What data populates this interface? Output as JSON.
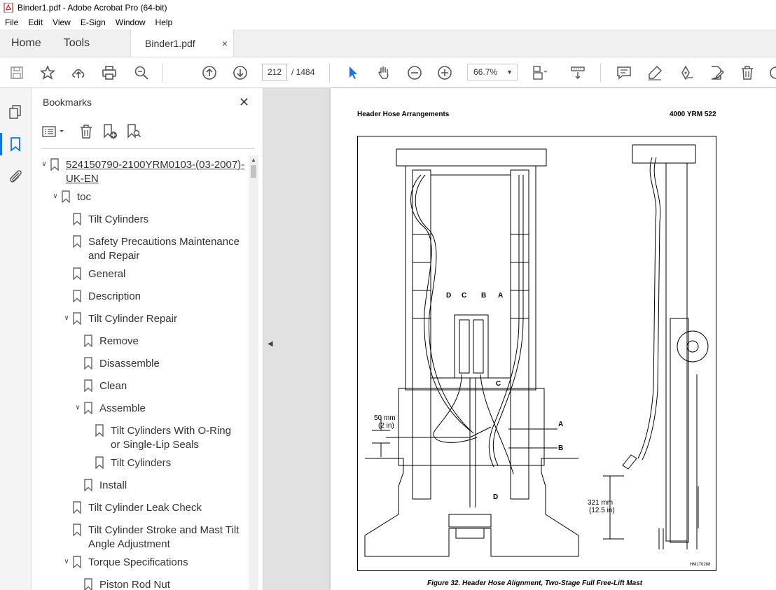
{
  "window": {
    "title": "Binder1.pdf - Adobe Acrobat Pro (64-bit)"
  },
  "menu": [
    "File",
    "Edit",
    "View",
    "E-Sign",
    "Window",
    "Help"
  ],
  "tabs": {
    "home": "Home",
    "tools": "Tools",
    "document": "Binder1.pdf",
    "close_glyph": "×"
  },
  "toolbar": {
    "page_current": "212",
    "page_total": "/  1484",
    "zoom": "66.7%"
  },
  "bookmarks": {
    "title": "Bookmarks",
    "close_glyph": "✕",
    "items": [
      {
        "label": "524150790-2100YRM0103-(03-2007)-",
        "label2": "UK-EN"
      },
      {
        "label": "toc"
      },
      {
        "label": "Tilt Cylinders"
      },
      {
        "label": "Safety Precautions Maintenance",
        "label2": "and Repair"
      },
      {
        "label": "General"
      },
      {
        "label": "Description"
      },
      {
        "label": "Tilt Cylinder Repair"
      },
      {
        "label": "Remove"
      },
      {
        "label": "Disassemble"
      },
      {
        "label": "Clean"
      },
      {
        "label": "Assemble"
      },
      {
        "label": "Tilt Cylinders With O-Ring",
        "label2": "or Single-Lip Seals"
      },
      {
        "label": "Tilt Cylinders"
      },
      {
        "label": "Install"
      },
      {
        "label": "Tilt Cylinder Leak Check"
      },
      {
        "label": "Tilt Cylinder Stroke and Mast Tilt",
        "label2": "Angle Adjustment"
      },
      {
        "label": "Torque Specifications"
      },
      {
        "label": "Piston Rod Nut"
      }
    ]
  },
  "document": {
    "header_left": "Header Hose Arrangements",
    "header_right": "4000 YRM 522",
    "figure": {
      "letters": {
        "D": "D",
        "C": "C",
        "B": "B",
        "A": "A"
      },
      "dim_50_mm": "50 mm",
      "dim_50_in": "(2 in)",
      "dim_321_mm": "321 mm",
      "dim_321_in": "(12.5 in)",
      "code": "HM170288"
    },
    "caption": "Figure 32. Header Hose Alignment, Two-Stage Full Free-Lift Mast"
  }
}
